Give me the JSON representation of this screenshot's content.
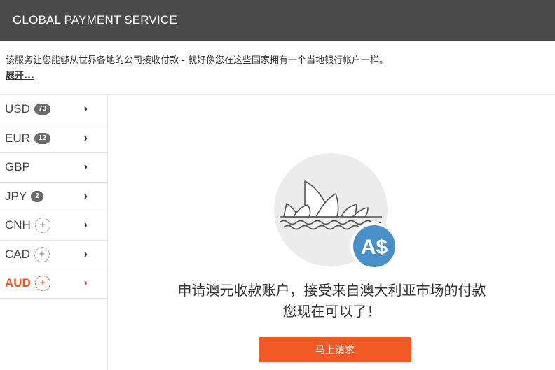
{
  "header": {
    "title": "GLOBAL PAYMENT SERVICE"
  },
  "intro": {
    "text": "该服务让您能够从世界各地的公司接收付款 - 就好像您在这些国家拥有一个当地银行帐户一样。",
    "expand_label": "展开..."
  },
  "sidebar": {
    "items": [
      {
        "code": "USD",
        "count": "73",
        "chevron": "›"
      },
      {
        "code": "EUR",
        "count": "12",
        "chevron": "›"
      },
      {
        "code": "GBP",
        "chevron": "›"
      },
      {
        "code": "JPY",
        "count": "2",
        "chevron": "›"
      },
      {
        "code": "CNH",
        "add": "+",
        "chevron": "›"
      },
      {
        "code": "CAD",
        "add": "+",
        "chevron": "›"
      },
      {
        "code": "AUD",
        "add": "+",
        "chevron": "›",
        "active": true
      }
    ]
  },
  "main": {
    "illustration": {
      "icon": "sydney-opera-house-icon",
      "badge": "A$"
    },
    "headline_line1": "申请澳元收款账户，接受来自澳大利亚市场的付款",
    "headline_line2": "您现在可以了！",
    "apply_button": "马上请求"
  },
  "colors": {
    "header_bg": "#4a4a4a",
    "accent": "#f15a24",
    "active_text": "#e8562a",
    "aud_badge": "#4a90c8"
  }
}
